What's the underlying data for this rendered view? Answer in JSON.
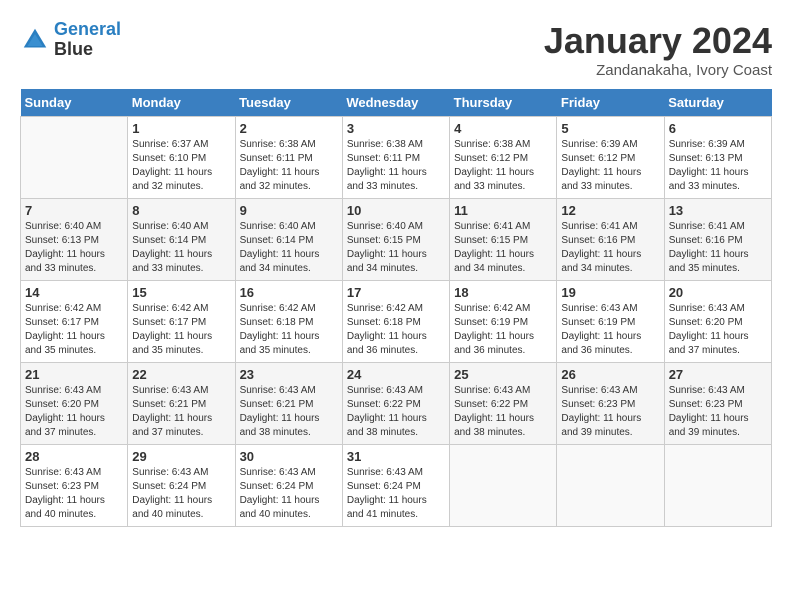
{
  "header": {
    "logo_line1": "General",
    "logo_line2": "Blue",
    "month_title": "January 2024",
    "location": "Zandanakaha, Ivory Coast"
  },
  "days_of_week": [
    "Sunday",
    "Monday",
    "Tuesday",
    "Wednesday",
    "Thursday",
    "Friday",
    "Saturday"
  ],
  "weeks": [
    [
      {
        "day": "",
        "sunrise": "",
        "sunset": "",
        "daylight": ""
      },
      {
        "day": "1",
        "sunrise": "Sunrise: 6:37 AM",
        "sunset": "Sunset: 6:10 PM",
        "daylight": "Daylight: 11 hours and 32 minutes."
      },
      {
        "day": "2",
        "sunrise": "Sunrise: 6:38 AM",
        "sunset": "Sunset: 6:11 PM",
        "daylight": "Daylight: 11 hours and 32 minutes."
      },
      {
        "day": "3",
        "sunrise": "Sunrise: 6:38 AM",
        "sunset": "Sunset: 6:11 PM",
        "daylight": "Daylight: 11 hours and 33 minutes."
      },
      {
        "day": "4",
        "sunrise": "Sunrise: 6:38 AM",
        "sunset": "Sunset: 6:12 PM",
        "daylight": "Daylight: 11 hours and 33 minutes."
      },
      {
        "day": "5",
        "sunrise": "Sunrise: 6:39 AM",
        "sunset": "Sunset: 6:12 PM",
        "daylight": "Daylight: 11 hours and 33 minutes."
      },
      {
        "day": "6",
        "sunrise": "Sunrise: 6:39 AM",
        "sunset": "Sunset: 6:13 PM",
        "daylight": "Daylight: 11 hours and 33 minutes."
      }
    ],
    [
      {
        "day": "7",
        "sunrise": "Sunrise: 6:40 AM",
        "sunset": "Sunset: 6:13 PM",
        "daylight": "Daylight: 11 hours and 33 minutes."
      },
      {
        "day": "8",
        "sunrise": "Sunrise: 6:40 AM",
        "sunset": "Sunset: 6:14 PM",
        "daylight": "Daylight: 11 hours and 33 minutes."
      },
      {
        "day": "9",
        "sunrise": "Sunrise: 6:40 AM",
        "sunset": "Sunset: 6:14 PM",
        "daylight": "Daylight: 11 hours and 34 minutes."
      },
      {
        "day": "10",
        "sunrise": "Sunrise: 6:40 AM",
        "sunset": "Sunset: 6:15 PM",
        "daylight": "Daylight: 11 hours and 34 minutes."
      },
      {
        "day": "11",
        "sunrise": "Sunrise: 6:41 AM",
        "sunset": "Sunset: 6:15 PM",
        "daylight": "Daylight: 11 hours and 34 minutes."
      },
      {
        "day": "12",
        "sunrise": "Sunrise: 6:41 AM",
        "sunset": "Sunset: 6:16 PM",
        "daylight": "Daylight: 11 hours and 34 minutes."
      },
      {
        "day": "13",
        "sunrise": "Sunrise: 6:41 AM",
        "sunset": "Sunset: 6:16 PM",
        "daylight": "Daylight: 11 hours and 35 minutes."
      }
    ],
    [
      {
        "day": "14",
        "sunrise": "Sunrise: 6:42 AM",
        "sunset": "Sunset: 6:17 PM",
        "daylight": "Daylight: 11 hours and 35 minutes."
      },
      {
        "day": "15",
        "sunrise": "Sunrise: 6:42 AM",
        "sunset": "Sunset: 6:17 PM",
        "daylight": "Daylight: 11 hours and 35 minutes."
      },
      {
        "day": "16",
        "sunrise": "Sunrise: 6:42 AM",
        "sunset": "Sunset: 6:18 PM",
        "daylight": "Daylight: 11 hours and 35 minutes."
      },
      {
        "day": "17",
        "sunrise": "Sunrise: 6:42 AM",
        "sunset": "Sunset: 6:18 PM",
        "daylight": "Daylight: 11 hours and 36 minutes."
      },
      {
        "day": "18",
        "sunrise": "Sunrise: 6:42 AM",
        "sunset": "Sunset: 6:19 PM",
        "daylight": "Daylight: 11 hours and 36 minutes."
      },
      {
        "day": "19",
        "sunrise": "Sunrise: 6:43 AM",
        "sunset": "Sunset: 6:19 PM",
        "daylight": "Daylight: 11 hours and 36 minutes."
      },
      {
        "day": "20",
        "sunrise": "Sunrise: 6:43 AM",
        "sunset": "Sunset: 6:20 PM",
        "daylight": "Daylight: 11 hours and 37 minutes."
      }
    ],
    [
      {
        "day": "21",
        "sunrise": "Sunrise: 6:43 AM",
        "sunset": "Sunset: 6:20 PM",
        "daylight": "Daylight: 11 hours and 37 minutes."
      },
      {
        "day": "22",
        "sunrise": "Sunrise: 6:43 AM",
        "sunset": "Sunset: 6:21 PM",
        "daylight": "Daylight: 11 hours and 37 minutes."
      },
      {
        "day": "23",
        "sunrise": "Sunrise: 6:43 AM",
        "sunset": "Sunset: 6:21 PM",
        "daylight": "Daylight: 11 hours and 38 minutes."
      },
      {
        "day": "24",
        "sunrise": "Sunrise: 6:43 AM",
        "sunset": "Sunset: 6:22 PM",
        "daylight": "Daylight: 11 hours and 38 minutes."
      },
      {
        "day": "25",
        "sunrise": "Sunrise: 6:43 AM",
        "sunset": "Sunset: 6:22 PM",
        "daylight": "Daylight: 11 hours and 38 minutes."
      },
      {
        "day": "26",
        "sunrise": "Sunrise: 6:43 AM",
        "sunset": "Sunset: 6:23 PM",
        "daylight": "Daylight: 11 hours and 39 minutes."
      },
      {
        "day": "27",
        "sunrise": "Sunrise: 6:43 AM",
        "sunset": "Sunset: 6:23 PM",
        "daylight": "Daylight: 11 hours and 39 minutes."
      }
    ],
    [
      {
        "day": "28",
        "sunrise": "Sunrise: 6:43 AM",
        "sunset": "Sunset: 6:23 PM",
        "daylight": "Daylight: 11 hours and 40 minutes."
      },
      {
        "day": "29",
        "sunrise": "Sunrise: 6:43 AM",
        "sunset": "Sunset: 6:24 PM",
        "daylight": "Daylight: 11 hours and 40 minutes."
      },
      {
        "day": "30",
        "sunrise": "Sunrise: 6:43 AM",
        "sunset": "Sunset: 6:24 PM",
        "daylight": "Daylight: 11 hours and 40 minutes."
      },
      {
        "day": "31",
        "sunrise": "Sunrise: 6:43 AM",
        "sunset": "Sunset: 6:24 PM",
        "daylight": "Daylight: 11 hours and 41 minutes."
      },
      {
        "day": "",
        "sunrise": "",
        "sunset": "",
        "daylight": ""
      },
      {
        "day": "",
        "sunrise": "",
        "sunset": "",
        "daylight": ""
      },
      {
        "day": "",
        "sunrise": "",
        "sunset": "",
        "daylight": ""
      }
    ]
  ]
}
